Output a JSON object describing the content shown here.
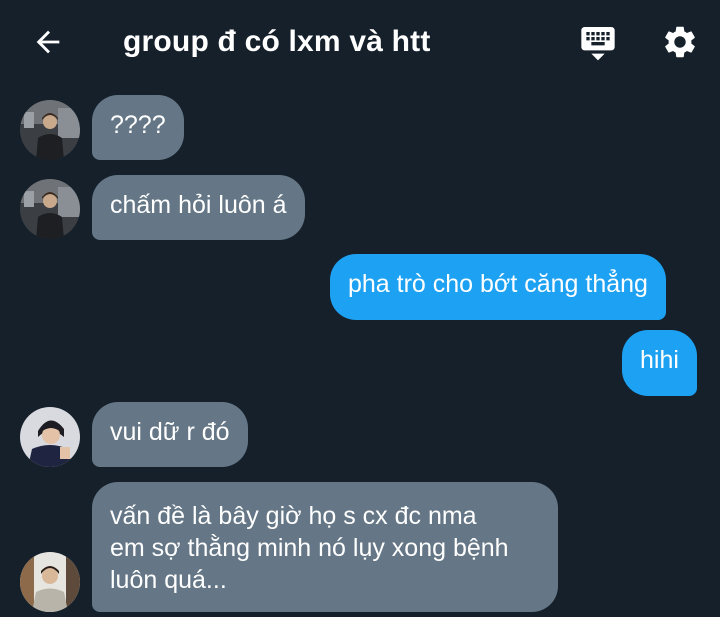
{
  "header": {
    "title": "group đ có lxm và htt",
    "back_icon": "arrow-left-icon",
    "keyboard_icon": "keyboard-icon",
    "settings_icon": "gear-icon"
  },
  "colors": {
    "background": "#15202b",
    "incoming_bubble": "#657786",
    "outgoing_bubble": "#1da1f2",
    "text": "#ffffff"
  },
  "messages": [
    {
      "direction": "incoming",
      "text": "????"
    },
    {
      "direction": "incoming",
      "text": "chấm hỏi luôn á"
    },
    {
      "direction": "outgoing",
      "text": "pha trò cho bớt căng thẳng"
    },
    {
      "direction": "outgoing",
      "text": "hihi"
    },
    {
      "direction": "incoming",
      "text": "vui dữ r đó"
    },
    {
      "direction": "incoming",
      "lines": [
        "vấn đề là bây giờ họ s cx đc nma",
        "em sợ thằng minh nó lụy xong bệnh",
        "luôn quá..."
      ]
    }
  ]
}
